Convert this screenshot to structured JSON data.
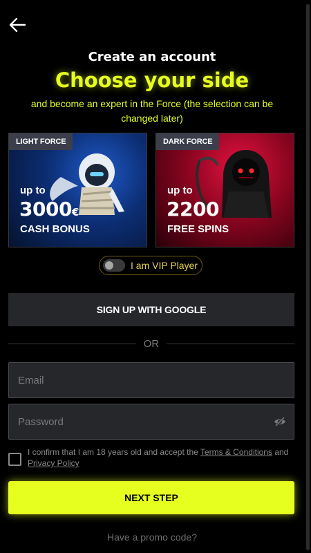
{
  "header": {
    "back_icon": "arrow-left-icon",
    "title": "Create an account",
    "headline": "Choose your side",
    "subtitle": "and become an expert in the Force (the selection can be changed later)"
  },
  "cards": [
    {
      "tag": "LIGHT FORCE",
      "up_to": "up to",
      "amount": "3000",
      "currency": "€",
      "bonus": "CASH BONUS",
      "accent": "#1f5ac8"
    },
    {
      "tag": "DARK FORCE",
      "up_to": "up to",
      "amount": "2200",
      "currency": "",
      "bonus": "FREE SPINS",
      "accent": "#e4123f"
    }
  ],
  "vip": {
    "label": "I am VIP Player",
    "enabled": false
  },
  "google_button": "SIGN UP WITH GOOGLE",
  "divider_text": "OR",
  "form": {
    "email_placeholder": "Email",
    "email_value": "",
    "password_placeholder": "Password",
    "password_value": "",
    "eye_icon": "eye-slash-icon"
  },
  "consent": {
    "prefix": "I confirm that I am 18 years old and accept the",
    "terms": "Terms & Conditions",
    "middle": "and",
    "privacy": "Privacy Policy",
    "checked": false
  },
  "next_button": "NEXT STEP",
  "promo_link": "Have a promo code?",
  "colors": {
    "accent": "#e6ff1f",
    "background": "#000000",
    "field_bg": "#26272b",
    "vip_text": "#e8d44d"
  }
}
